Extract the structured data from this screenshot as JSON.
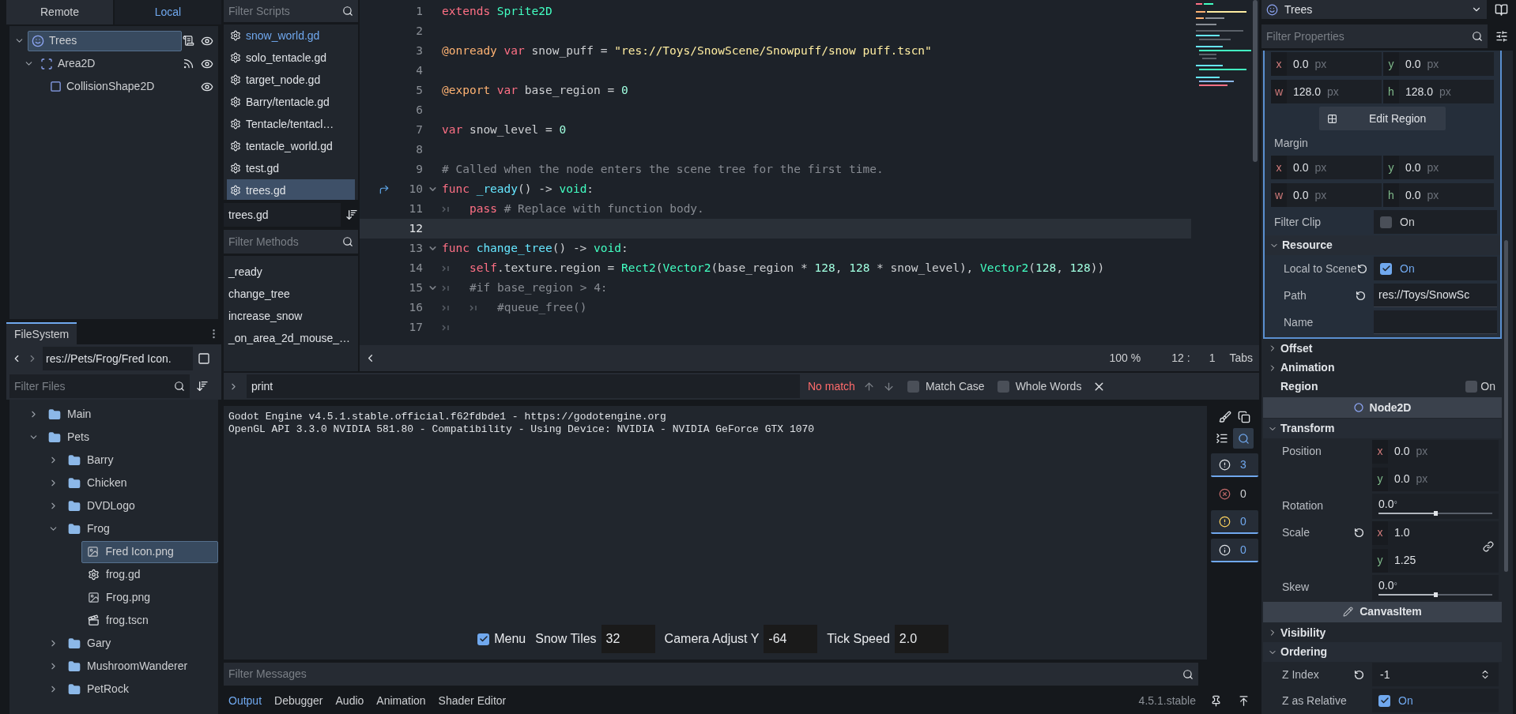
{
  "scene_dock": {
    "tabs": [
      {
        "label": "Remote",
        "selected": false
      },
      {
        "label": "Local",
        "selected": true
      }
    ],
    "tree": [
      {
        "name": "Trees",
        "kind": "sprite",
        "selected": true,
        "expanded": true,
        "script": true,
        "signals": false,
        "visible": true,
        "children": [
          {
            "name": "Area2D",
            "kind": "area",
            "selected": false,
            "expanded": true,
            "script": false,
            "signals": true,
            "visible": true,
            "children": [
              {
                "name": "CollisionShape2D",
                "kind": "shape",
                "selected": false,
                "script": false,
                "signals": false,
                "visible": true
              }
            ]
          }
        ]
      }
    ]
  },
  "filesystem": {
    "tab": "FileSystem",
    "path": "res://Pets/Frog/Fred Icon.",
    "filter_placeholder": "Filter Files",
    "tree": [
      {
        "name": "Main",
        "kind": "folder",
        "expanded": false,
        "selected": false
      },
      {
        "name": "Pets",
        "kind": "folder",
        "expanded": true,
        "selected": false,
        "children": [
          {
            "name": "Barry",
            "kind": "folder",
            "expanded": false,
            "selected": false
          },
          {
            "name": "Chicken",
            "kind": "folder",
            "expanded": false,
            "selected": false
          },
          {
            "name": "DVDLogo",
            "kind": "folder",
            "expanded": false,
            "selected": false
          },
          {
            "name": "Frog",
            "kind": "folder",
            "expanded": true,
            "selected": false,
            "children": [
              {
                "name": "Fred Icon.png",
                "kind": "image",
                "selected": true
              },
              {
                "name": "frog.gd",
                "kind": "script",
                "selected": false
              },
              {
                "name": "Frog.png",
                "kind": "image",
                "selected": false
              },
              {
                "name": "frog.tscn",
                "kind": "scene",
                "selected": false
              }
            ]
          },
          {
            "name": "Gary",
            "kind": "folder",
            "expanded": false,
            "selected": false
          },
          {
            "name": "MushroomWanderer",
            "kind": "folder",
            "expanded": false,
            "selected": false
          },
          {
            "name": "PetRock",
            "kind": "folder",
            "expanded": false,
            "selected": false
          }
        ]
      }
    ]
  },
  "scripts": {
    "filter_placeholder": "Filter Scripts",
    "items": [
      {
        "name": "snow_world.gd",
        "selected": false,
        "hovered": true
      },
      {
        "name": "solo_tentacle.gd",
        "selected": false,
        "hovered": false
      },
      {
        "name": "target_node.gd",
        "selected": false,
        "hovered": false
      },
      {
        "name": "Barry/tentacle.gd",
        "selected": false,
        "hovered": false
      },
      {
        "name": "Tentacle/tentacl…",
        "selected": false,
        "hovered": false
      },
      {
        "name": "tentacle_world.gd",
        "selected": false,
        "hovered": false
      },
      {
        "name": "test.gd",
        "selected": false,
        "hovered": false
      },
      {
        "name": "trees.gd",
        "selected": true,
        "hovered": false
      }
    ],
    "current": "trees.gd",
    "methods_placeholder": "Filter Methods",
    "methods": [
      "_ready",
      "change_tree",
      "increase_snow",
      "_on_area_2d_mouse_…"
    ]
  },
  "editor": {
    "lines": [
      {
        "number": "1",
        "current": false,
        "foldable": false,
        "connected": false,
        "tokens": [
          {
            "kind": "keyword",
            "text": "extends "
          },
          {
            "kind": "type",
            "text": "Sprite2D"
          }
        ]
      },
      {
        "number": "2",
        "current": false,
        "foldable": false,
        "connected": false
      },
      {
        "number": "3",
        "current": false,
        "foldable": false,
        "connected": false,
        "tokens": [
          {
            "kind": "annotation",
            "text": "@onready "
          },
          {
            "kind": "keyword",
            "text": "var "
          },
          {
            "kind": "plain",
            "text": "snow_puff = "
          },
          {
            "kind": "string",
            "text": "\"res://Toys/SnowScene/Snowpuff/snow puff.tscn\""
          }
        ]
      },
      {
        "number": "4",
        "current": false,
        "foldable": false,
        "connected": false
      },
      {
        "number": "5",
        "current": false,
        "foldable": false,
        "connected": false,
        "tokens": [
          {
            "kind": "annotation",
            "text": "@export "
          },
          {
            "kind": "keyword",
            "text": "var "
          },
          {
            "kind": "plain",
            "text": "base_region = "
          },
          {
            "kind": "number",
            "text": "0"
          }
        ]
      },
      {
        "number": "6",
        "current": false,
        "foldable": false,
        "connected": false
      },
      {
        "number": "7",
        "current": false,
        "foldable": false,
        "connected": false,
        "tokens": [
          {
            "kind": "keyword",
            "text": "var "
          },
          {
            "kind": "plain",
            "text": "snow_level = "
          },
          {
            "kind": "number",
            "text": "0"
          }
        ]
      },
      {
        "number": "8",
        "current": false,
        "foldable": false,
        "connected": false
      },
      {
        "number": "9",
        "current": false,
        "foldable": false,
        "connected": false,
        "tokens": [
          {
            "kind": "comment",
            "text": "# Called when the node enters the scene tree for the first time."
          }
        ]
      },
      {
        "number": "10",
        "current": false,
        "foldable": true,
        "connected": true,
        "tokens": [
          {
            "kind": "keyword",
            "text": "func "
          },
          {
            "kind": "func",
            "text": "_ready"
          },
          {
            "kind": "plain",
            "text": "() -> "
          },
          {
            "kind": "type",
            "text": "void"
          },
          {
            "kind": "plain",
            "text": ":"
          }
        ]
      },
      {
        "number": "11",
        "current": false,
        "foldable": false,
        "connected": false,
        "tokens": [
          {
            "kind": "tab"
          },
          {
            "kind": "keyword",
            "text": "pass "
          },
          {
            "kind": "comment",
            "text": "# Replace with function body."
          }
        ]
      },
      {
        "number": "12",
        "current": true,
        "foldable": false,
        "connected": false
      },
      {
        "number": "13",
        "current": false,
        "foldable": true,
        "connected": false,
        "tokens": [
          {
            "kind": "keyword",
            "text": "func "
          },
          {
            "kind": "func",
            "text": "change_tree"
          },
          {
            "kind": "plain",
            "text": "() -> "
          },
          {
            "kind": "type",
            "text": "void"
          },
          {
            "kind": "plain",
            "text": ":"
          }
        ]
      },
      {
        "number": "14",
        "current": false,
        "foldable": false,
        "connected": false,
        "tokens": [
          {
            "kind": "tab"
          },
          {
            "kind": "keyword",
            "text": "self"
          },
          {
            "kind": "plain",
            "text": ".texture.region = "
          },
          {
            "kind": "type",
            "text": "Rect2"
          },
          {
            "kind": "plain",
            "text": "("
          },
          {
            "kind": "type",
            "text": "Vector2"
          },
          {
            "kind": "plain",
            "text": "(base_region * "
          },
          {
            "kind": "number",
            "text": "128"
          },
          {
            "kind": "plain",
            "text": ", "
          },
          {
            "kind": "number",
            "text": "128"
          },
          {
            "kind": "plain",
            "text": " * snow_level), "
          },
          {
            "kind": "type",
            "text": "Vector2"
          },
          {
            "kind": "plain",
            "text": "("
          },
          {
            "kind": "number",
            "text": "128"
          },
          {
            "kind": "plain",
            "text": ", "
          },
          {
            "kind": "number",
            "text": "128"
          },
          {
            "kind": "plain",
            "text": "))"
          }
        ]
      },
      {
        "number": "15",
        "current": false,
        "foldable": true,
        "connected": false,
        "tokens": [
          {
            "kind": "tab"
          },
          {
            "kind": "comment",
            "text": "#if base_region > 4:"
          }
        ]
      },
      {
        "number": "16",
        "current": false,
        "foldable": false,
        "connected": false,
        "tokens": [
          {
            "kind": "tab"
          },
          {
            "kind": "tab"
          },
          {
            "kind": "comment",
            "text": "#queue_free()"
          }
        ]
      },
      {
        "number": "17",
        "current": false,
        "foldable": false,
        "connected": false,
        "tokens": [
          {
            "kind": "tab"
          }
        ]
      }
    ],
    "status": {
      "zoom": "100 %",
      "line": "12 :",
      "column": "1",
      "indent": "Tabs"
    }
  },
  "find": {
    "value": "print",
    "result": "No match",
    "options": [
      {
        "label": "Match Case",
        "checked": false
      },
      {
        "label": "Whole Words",
        "checked": false
      }
    ]
  },
  "output": {
    "lines": [
      "Godot Engine v4.5.1.stable.official.f62fdbde1 - https://godotengine.org",
      "OpenGL API 3.3.0 NVIDIA 581.80 - Compatibility - Using Device: NVIDIA - NVIDIA GeForce GTX 1070"
    ],
    "search_on": true,
    "counters": [
      {
        "kind": "message",
        "count": "3",
        "on": true
      },
      {
        "kind": "error",
        "count": "0",
        "on": false
      },
      {
        "kind": "warning",
        "count": "0",
        "on": true
      },
      {
        "kind": "editor",
        "count": "0",
        "on": true
      }
    ],
    "game_controls": [
      {
        "kind": "check",
        "label": "Menu",
        "checked": true
      },
      {
        "kind": "field",
        "label": "Snow Tiles",
        "value": "32"
      },
      {
        "kind": "field",
        "label": "Camera Adjust Y",
        "value": "-64"
      },
      {
        "kind": "field",
        "label": "Tick Speed",
        "value": "2.0"
      }
    ],
    "filter_placeholder": "Filter Messages"
  },
  "bottom_tabs": [
    {
      "label": "Output",
      "selected": true
    },
    {
      "label": "Debugger",
      "selected": false
    },
    {
      "label": "Audio",
      "selected": false
    },
    {
      "label": "Animation",
      "selected": false
    },
    {
      "label": "Shader Editor",
      "selected": false
    }
  ],
  "version": "4.5.1.stable",
  "inspector": {
    "node": "Trees",
    "filter_placeholder": "Filter Properties",
    "subresource": [
      {
        "kind": "vec4",
        "fields": [
          {
            "axis": "x",
            "value": "0.0",
            "unit": "px"
          },
          {
            "axis": "y",
            "value": "0.0",
            "unit": "px"
          },
          {
            "axis": "w",
            "value": "128.0",
            "unit": "px"
          },
          {
            "axis": "h",
            "value": "128.0",
            "unit": "px"
          }
        ]
      },
      {
        "kind": "button",
        "label": "Edit Region"
      },
      {
        "kind": "label",
        "label": "Margin"
      },
      {
        "kind": "vec4",
        "fields": [
          {
            "axis": "x",
            "value": "0.0",
            "unit": "px"
          },
          {
            "axis": "y",
            "value": "0.0",
            "unit": "px"
          },
          {
            "axis": "w",
            "value": "0.0",
            "unit": "px"
          },
          {
            "axis": "h",
            "value": "0.0",
            "unit": "px"
          }
        ]
      },
      {
        "kind": "check",
        "label": "Filter Clip",
        "revert": false,
        "checked": false,
        "text": "On"
      },
      {
        "kind": "group",
        "label": "Resource",
        "expanded": true
      },
      {
        "kind": "check",
        "label": "Local to Scene",
        "revert": true,
        "checked": true,
        "text": "On"
      },
      {
        "kind": "text",
        "label": "Path",
        "revert": true,
        "value": "res://Toys/SnowSc"
      },
      {
        "kind": "text",
        "label": "Name",
        "revert": false
      }
    ],
    "properties": [
      {
        "kind": "group",
        "label": "Offset",
        "expanded": false
      },
      {
        "kind": "group",
        "label": "Animation",
        "expanded": false
      },
      {
        "kind": "group_check",
        "label": "Region",
        "checked": false,
        "text": "On"
      },
      {
        "kind": "class",
        "label": "Node2D"
      },
      {
        "kind": "group",
        "label": "Transform",
        "expanded": true
      },
      {
        "kind": "vec2",
        "label": "Position",
        "revert": false,
        "linkable": false,
        "fields": [
          {
            "axis": "x",
            "value": "0.0",
            "unit": "px"
          },
          {
            "axis": "y",
            "value": "0.0",
            "unit": "px"
          }
        ]
      },
      {
        "kind": "slider",
        "label": "Rotation",
        "value": "0.0",
        "unit": "°",
        "level": 0.5
      },
      {
        "kind": "vec2",
        "label": "Scale",
        "revert": true,
        "linkable": true,
        "fields": [
          {
            "axis": "x",
            "value": "1.0"
          },
          {
            "axis": "y",
            "value": "1.25"
          }
        ]
      },
      {
        "kind": "slider",
        "label": "Skew",
        "value": "0.0",
        "unit": "°",
        "level": 0.5
      },
      {
        "kind": "class",
        "label": "CanvasItem"
      },
      {
        "kind": "group",
        "label": "Visibility",
        "expanded": false
      },
      {
        "kind": "group",
        "label": "Ordering",
        "expanded": true
      },
      {
        "kind": "spin",
        "label": "Z Index",
        "revert": true,
        "value": "-1"
      },
      {
        "kind": "check",
        "label": "Z as Relative",
        "revert": false,
        "checked": true,
        "text": "On"
      }
    ]
  }
}
